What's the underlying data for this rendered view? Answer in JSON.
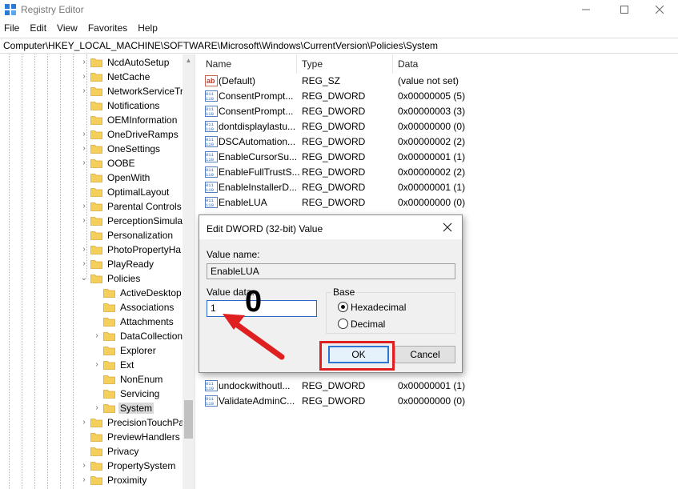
{
  "window": {
    "title": "Registry Editor",
    "controls": [
      "minimize-icon",
      "maximize-icon",
      "close-icon"
    ]
  },
  "menu": [
    "File",
    "Edit",
    "View",
    "Favorites",
    "Help"
  ],
  "address": "Computer\\HKEY_LOCAL_MACHINE\\SOFTWARE\\Microsoft\\Windows\\CurrentVersion\\Policies\\System",
  "tree": {
    "items": [
      {
        "label": "NcdAutoSetup",
        "expander": "collapsed"
      },
      {
        "label": "NetCache",
        "expander": "collapsed"
      },
      {
        "label": "NetworkServiceTr",
        "expander": "collapsed"
      },
      {
        "label": "Notifications",
        "expander": "none"
      },
      {
        "label": "OEMInformation",
        "expander": "none"
      },
      {
        "label": "OneDriveRamps",
        "expander": "collapsed"
      },
      {
        "label": "OneSettings",
        "expander": "collapsed"
      },
      {
        "label": "OOBE",
        "expander": "collapsed"
      },
      {
        "label": "OpenWith",
        "expander": "none"
      },
      {
        "label": "OptimalLayout",
        "expander": "none"
      },
      {
        "label": "Parental Controls",
        "expander": "collapsed"
      },
      {
        "label": "PerceptionSimula",
        "expander": "collapsed"
      },
      {
        "label": "Personalization",
        "expander": "none"
      },
      {
        "label": "PhotoPropertyHa",
        "expander": "collapsed"
      },
      {
        "label": "PlayReady",
        "expander": "collapsed"
      },
      {
        "label": "Policies",
        "expander": "expanded"
      },
      {
        "label": "ActiveDesktop",
        "expander": "none",
        "child": true
      },
      {
        "label": "Associations",
        "expander": "none",
        "child": true
      },
      {
        "label": "Attachments",
        "expander": "none",
        "child": true
      },
      {
        "label": "DataCollection",
        "expander": "collapsed",
        "child": true
      },
      {
        "label": "Explorer",
        "expander": "none",
        "child": true
      },
      {
        "label": "Ext",
        "expander": "collapsed",
        "child": true
      },
      {
        "label": "NonEnum",
        "expander": "none",
        "child": true
      },
      {
        "label": "Servicing",
        "expander": "none",
        "child": true
      },
      {
        "label": "System",
        "expander": "collapsed",
        "child": true,
        "selected": true
      },
      {
        "label": "PrecisionTouchPa",
        "expander": "collapsed"
      },
      {
        "label": "PreviewHandlers",
        "expander": "none"
      },
      {
        "label": "Privacy",
        "expander": "none"
      },
      {
        "label": "PropertySystem",
        "expander": "collapsed"
      },
      {
        "label": "Proximity",
        "expander": "collapsed"
      }
    ]
  },
  "list": {
    "columns": [
      "Name",
      "Type",
      "Data"
    ],
    "rows": [
      {
        "icon": "string-value-icon",
        "name": "(Default)",
        "type": "REG_SZ",
        "data": "(value not set)"
      },
      {
        "icon": "binary-value-icon",
        "name": "ConsentPrompt...",
        "type": "REG_DWORD",
        "data": "0x00000005 (5)"
      },
      {
        "icon": "binary-value-icon",
        "name": "ConsentPrompt...",
        "type": "REG_DWORD",
        "data": "0x00000003 (3)"
      },
      {
        "icon": "binary-value-icon",
        "name": "dontdisplaylastu...",
        "type": "REG_DWORD",
        "data": "0x00000000 (0)"
      },
      {
        "icon": "binary-value-icon",
        "name": "DSCAutomation...",
        "type": "REG_DWORD",
        "data": "0x00000002 (2)"
      },
      {
        "icon": "binary-value-icon",
        "name": "EnableCursorSu...",
        "type": "REG_DWORD",
        "data": "0x00000001 (1)"
      },
      {
        "icon": "binary-value-icon",
        "name": "EnableFullTrustS...",
        "type": "REG_DWORD",
        "data": "0x00000002 (2)"
      },
      {
        "icon": "binary-value-icon",
        "name": "EnableInstallerD...",
        "type": "REG_DWORD",
        "data": "0x00000001 (1)"
      },
      {
        "icon": "binary-value-icon",
        "name": "EnableLUA",
        "type": "REG_DWORD",
        "data": "0x00000000 (0)"
      },
      {
        "icon": "binary-value-icon",
        "name": "undockwithoutl...",
        "type": "REG_DWORD",
        "data": "0x00000001 (1)"
      },
      {
        "icon": "binary-value-icon",
        "name": "ValidateAdminC...",
        "type": "REG_DWORD",
        "data": "0x00000000 (0)"
      }
    ]
  },
  "dialog": {
    "title": "Edit DWORD (32-bit) Value",
    "value_name_label": "Value name:",
    "value_name": "EnableLUA",
    "value_data_label": "Value data:",
    "value_data": "1",
    "base_label": "Base",
    "radio_hex": "Hexadecimal",
    "radio_dec": "Decimal",
    "base_selected": "Hexadecimal",
    "ok": "OK",
    "cancel": "Cancel"
  },
  "annotation": {
    "text": "0",
    "color": "#e02020"
  }
}
